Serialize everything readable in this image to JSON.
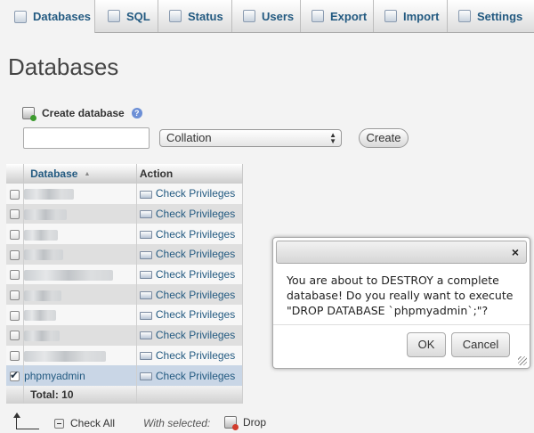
{
  "tabs": [
    {
      "label": "Databases",
      "icon": "database-icon",
      "active": true
    },
    {
      "label": "SQL",
      "icon": "sql-icon"
    },
    {
      "label": "Status",
      "icon": "status-icon"
    },
    {
      "label": "Users",
      "icon": "users-icon"
    },
    {
      "label": "Export",
      "icon": "export-icon"
    },
    {
      "label": "Import",
      "icon": "import-icon"
    },
    {
      "label": "Settings",
      "icon": "wrench-icon"
    }
  ],
  "page_title": "Databases",
  "create": {
    "heading": "Create database",
    "name_value": "",
    "collation_selected": "Collation",
    "button": "Create"
  },
  "table": {
    "headers": {
      "database": "Database",
      "action": "Action"
    },
    "rows": [
      {
        "name": "",
        "action": "Check Privileges",
        "checked": false
      },
      {
        "name": "",
        "action": "Check Privileges",
        "checked": false
      },
      {
        "name": "",
        "action": "Check Privileges",
        "checked": false
      },
      {
        "name": "",
        "action": "Check Privileges",
        "checked": false
      },
      {
        "name": "",
        "action": "Check Privileges",
        "checked": false
      },
      {
        "name": "",
        "action": "Check Privileges",
        "checked": false
      },
      {
        "name": "",
        "action": "Check Privileges",
        "checked": false
      },
      {
        "name": "",
        "action": "Check Privileges",
        "checked": false
      },
      {
        "name": "",
        "action": "Check Privileges",
        "checked": false
      },
      {
        "name": "phpmyadmin",
        "action": "Check Privileges",
        "checked": true
      }
    ],
    "total": "Total: 10"
  },
  "footer": {
    "check_all": "Check All",
    "with_selected": "With selected:",
    "drop": "Drop"
  },
  "dialog": {
    "close": "×",
    "message": "You are about to DESTROY a complete database! Do you really want to execute \"DROP DATABASE `phpmyadmin`;\"?",
    "ok": "OK",
    "cancel": "Cancel"
  },
  "colors": {
    "link": "#235a81",
    "marked_row": "#c9d6e6"
  }
}
